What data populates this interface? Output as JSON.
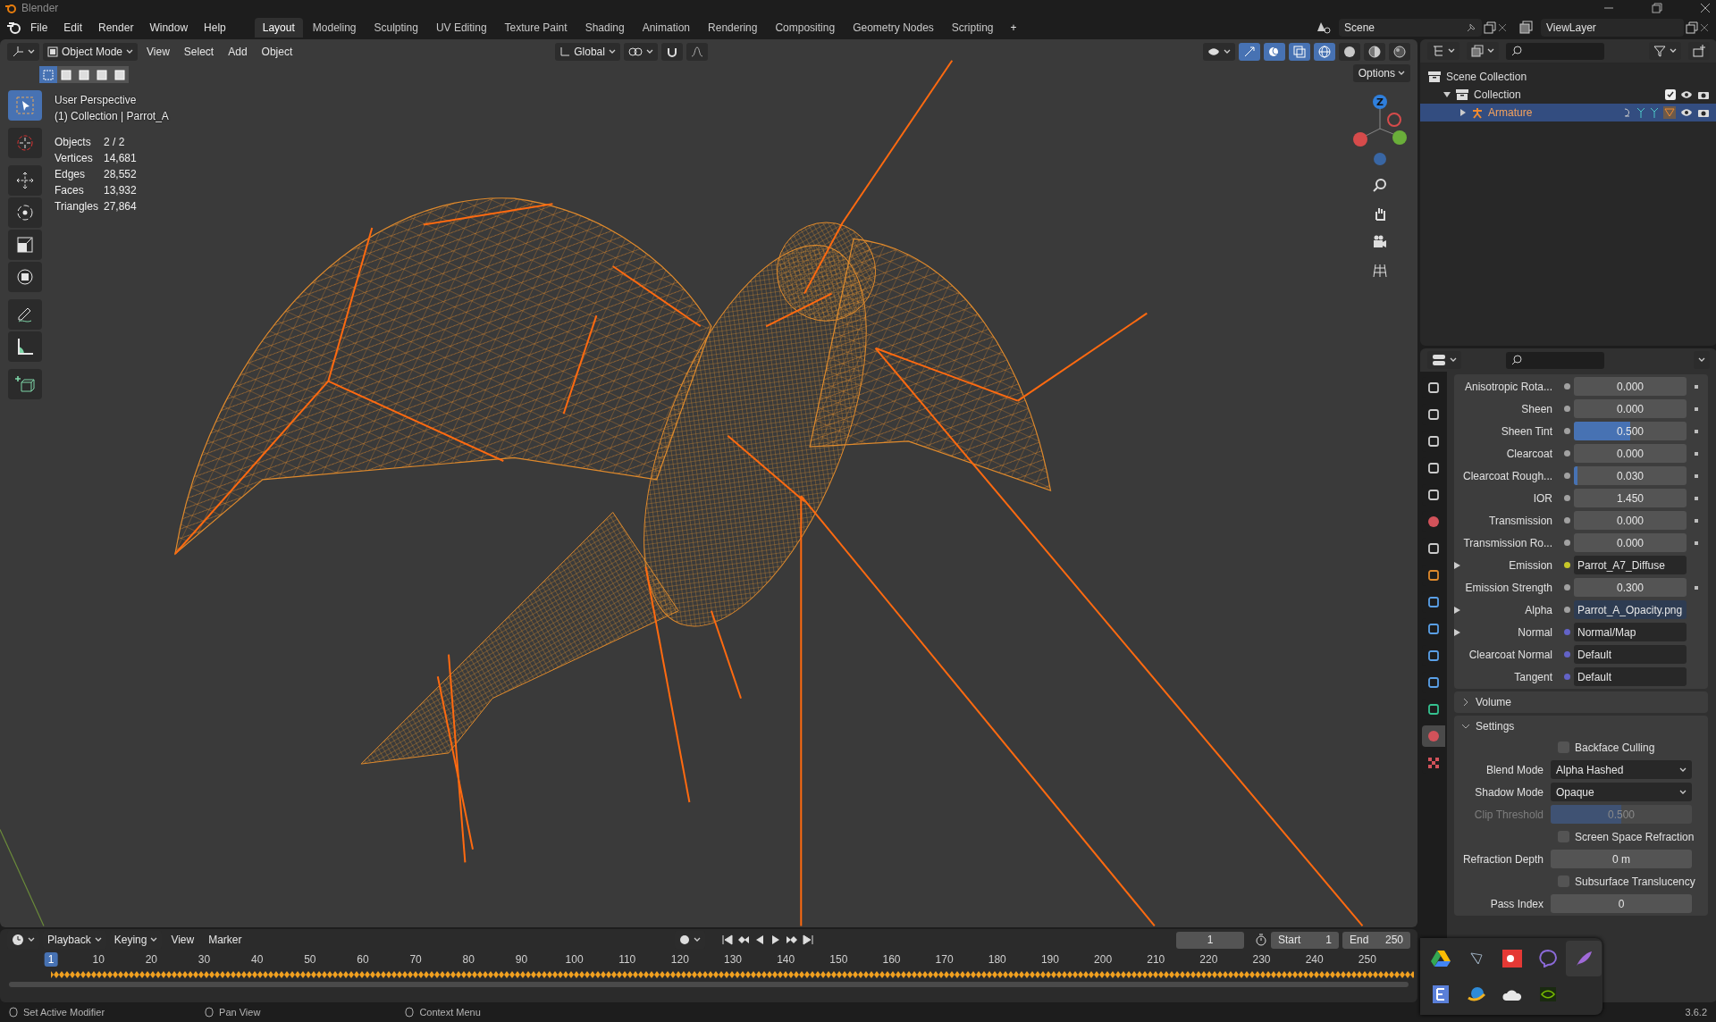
{
  "app": {
    "title": "Blender"
  },
  "menu": [
    "File",
    "Edit",
    "Render",
    "Window",
    "Help"
  ],
  "workspaces": [
    {
      "label": "Layout",
      "selected": true
    },
    {
      "label": "Modeling",
      "selected": false
    },
    {
      "label": "Sculpting",
      "selected": false
    },
    {
      "label": "UV Editing",
      "selected": false
    },
    {
      "label": "Texture Paint",
      "selected": false
    },
    {
      "label": "Shading",
      "selected": false
    },
    {
      "label": "Animation",
      "selected": false
    },
    {
      "label": "Rendering",
      "selected": false
    },
    {
      "label": "Compositing",
      "selected": false
    },
    {
      "label": "Geometry Nodes",
      "selected": false
    },
    {
      "label": "Scripting",
      "selected": false
    }
  ],
  "add_workspace": "+",
  "scene": {
    "scene": "Scene",
    "view_layer": "ViewLayer"
  },
  "viewport": {
    "mode": "Object Mode",
    "menus": [
      "View",
      "Select",
      "Add",
      "Object"
    ],
    "orientation": "Global",
    "options": "Options",
    "view_name": "User Perspective",
    "context": "(1) Collection | Parrot_A",
    "gizmo_label": "Z",
    "stats": [
      {
        "label": "Objects",
        "value": "2 / 2"
      },
      {
        "label": "Vertices",
        "value": "14,681"
      },
      {
        "label": "Edges",
        "value": "28,552"
      },
      {
        "label": "Faces",
        "value": "13,932"
      },
      {
        "label": "Triangles",
        "value": "27,864"
      }
    ],
    "select_modes": [
      {
        "selected": true
      },
      {
        "selected": false
      },
      {
        "selected": false
      },
      {
        "selected": false
      },
      {
        "selected": false
      }
    ],
    "tools": [
      {
        "kind": "select",
        "selected": true
      },
      {
        "kind": "cursor",
        "selected": false
      },
      {
        "kind": "move",
        "selected": false
      },
      {
        "kind": "rotate",
        "selected": false
      },
      {
        "kind": "scale",
        "selected": false
      },
      {
        "kind": "transform",
        "selected": false
      },
      {
        "kind": "annotate",
        "selected": false
      },
      {
        "kind": "measure",
        "selected": false
      },
      {
        "kind": "add-cube",
        "selected": false
      }
    ],
    "shading": [
      {
        "kind": "wireframe",
        "selected": true
      },
      {
        "kind": "solid",
        "selected": false
      },
      {
        "kind": "material",
        "selected": false
      },
      {
        "kind": "rendered",
        "selected": false
      }
    ]
  },
  "outliner": {
    "items": [
      {
        "label": "Scene Collection",
        "selected": false,
        "children": [
          {
            "label": "Collection",
            "selected": false,
            "expanded": true,
            "children": [
              {
                "label": "Armature",
                "selected": true,
                "expanded": false
              }
            ]
          }
        ]
      }
    ]
  },
  "properties": {
    "tabs": [
      {
        "selected": false
      },
      {
        "selected": false
      },
      {
        "selected": false
      },
      {
        "selected": false
      },
      {
        "selected": false
      },
      {
        "selected": false
      },
      {
        "selected": false
      },
      {
        "selected": false
      },
      {
        "selected": false
      },
      {
        "selected": false
      },
      {
        "selected": false
      },
      {
        "selected": false
      },
      {
        "selected": false
      },
      {
        "selected": true
      },
      {
        "selected": false
      }
    ],
    "rows": [
      {
        "kind": "slider",
        "label": "Anisotropic Rota...",
        "value": "0.000",
        "level": 0,
        "color": "#a1a1a1"
      },
      {
        "kind": "slider",
        "label": "Sheen",
        "value": "0.000",
        "level": 0,
        "color": "#a1a1a1"
      },
      {
        "kind": "slider",
        "label": "Sheen Tint",
        "value": "0.500",
        "level": 0.5,
        "color": "#a1a1a1"
      },
      {
        "kind": "slider",
        "label": "Clearcoat",
        "value": "0.000",
        "level": 0,
        "color": "#a1a1a1"
      },
      {
        "kind": "slider",
        "label": "Clearcoat Rough...",
        "value": "0.030",
        "level": 0.03,
        "color": "#a1a1a1"
      },
      {
        "kind": "number",
        "label": "IOR",
        "value": "1.450",
        "color": "#a1a1a1"
      },
      {
        "kind": "slider",
        "label": "Transmission",
        "value": "0.000",
        "level": 0,
        "color": "#a1a1a1"
      },
      {
        "kind": "slider",
        "label": "Transmission Ro...",
        "value": "0.000",
        "level": 0,
        "color": "#a1a1a1"
      },
      {
        "kind": "link",
        "label": "Emission",
        "value": "Parrot_A7_Diffuse",
        "color": "#c7c729",
        "selected": false
      },
      {
        "kind": "number",
        "label": "Emission Strength",
        "value": "0.300",
        "color": "#a1a1a1"
      },
      {
        "kind": "link",
        "label": "Alpha",
        "value": "Parrot_A_Opacity.png",
        "color": "#a1a1a1",
        "selected": true
      },
      {
        "kind": "link",
        "label": "Normal",
        "value": "Normal/Map",
        "color": "#6363c7",
        "selected": false
      },
      {
        "kind": "plain",
        "label": "Clearcoat Normal",
        "value": "Default",
        "color": "#6363c7"
      },
      {
        "kind": "plain",
        "label": "Tangent",
        "value": "Default",
        "color": "#6363c7"
      }
    ],
    "panels": [
      {
        "title": "Volume",
        "expanded": false
      },
      {
        "title": "Settings",
        "expanded": true
      }
    ],
    "settings": [
      {
        "kind": "checkbox",
        "label": "Backface Culling",
        "checked": false
      },
      {
        "kind": "dropdown",
        "label": "Blend Mode",
        "value": "Alpha Hashed"
      },
      {
        "kind": "dropdown",
        "label": "Shadow Mode",
        "value": "Opaque"
      },
      {
        "kind": "slider",
        "label": "Clip Threshold",
        "value": "0.500",
        "level": 0.5,
        "disabled": true
      },
      {
        "kind": "checkbox",
        "label": "Screen Space Refraction",
        "checked": false
      },
      {
        "kind": "field",
        "label": "Refraction Depth",
        "value": "0 m"
      },
      {
        "kind": "checkbox",
        "label": "Subsurface Translucency",
        "checked": false
      },
      {
        "kind": "field",
        "label": "Pass Index",
        "value": "0"
      }
    ]
  },
  "timeline": {
    "menus": [
      "Playback",
      "Keying",
      "View",
      "Marker"
    ],
    "current_frame": "1",
    "start_label": "Start",
    "start": "1",
    "end_label": "End",
    "end": "250",
    "ticks": [
      {
        "label": "1",
        "selected": true
      },
      {
        "label": "10",
        "selected": false
      },
      {
        "label": "20",
        "selected": false
      },
      {
        "label": "30",
        "selected": false
      },
      {
        "label": "40",
        "selected": false
      },
      {
        "label": "50",
        "selected": false
      },
      {
        "label": "60",
        "selected": false
      },
      {
        "label": "70",
        "selected": false
      },
      {
        "label": "80",
        "selected": false
      },
      {
        "label": "90",
        "selected": false
      },
      {
        "label": "100",
        "selected": false
      },
      {
        "label": "110",
        "selected": false
      },
      {
        "label": "120",
        "selected": false
      },
      {
        "label": "130",
        "selected": false
      },
      {
        "label": "140",
        "selected": false
      },
      {
        "label": "150",
        "selected": false
      },
      {
        "label": "160",
        "selected": false
      },
      {
        "label": "170",
        "selected": false
      },
      {
        "label": "180",
        "selected": false
      },
      {
        "label": "190",
        "selected": false
      },
      {
        "label": "200",
        "selected": false
      },
      {
        "label": "210",
        "selected": false
      },
      {
        "label": "220",
        "selected": false
      },
      {
        "label": "230",
        "selected": false
      },
      {
        "label": "240",
        "selected": false
      },
      {
        "label": "250",
        "selected": false
      }
    ]
  },
  "status": {
    "hints": [
      "Set Active Modifier",
      "Pan View",
      "Context Menu"
    ],
    "version": "3.6.2"
  }
}
